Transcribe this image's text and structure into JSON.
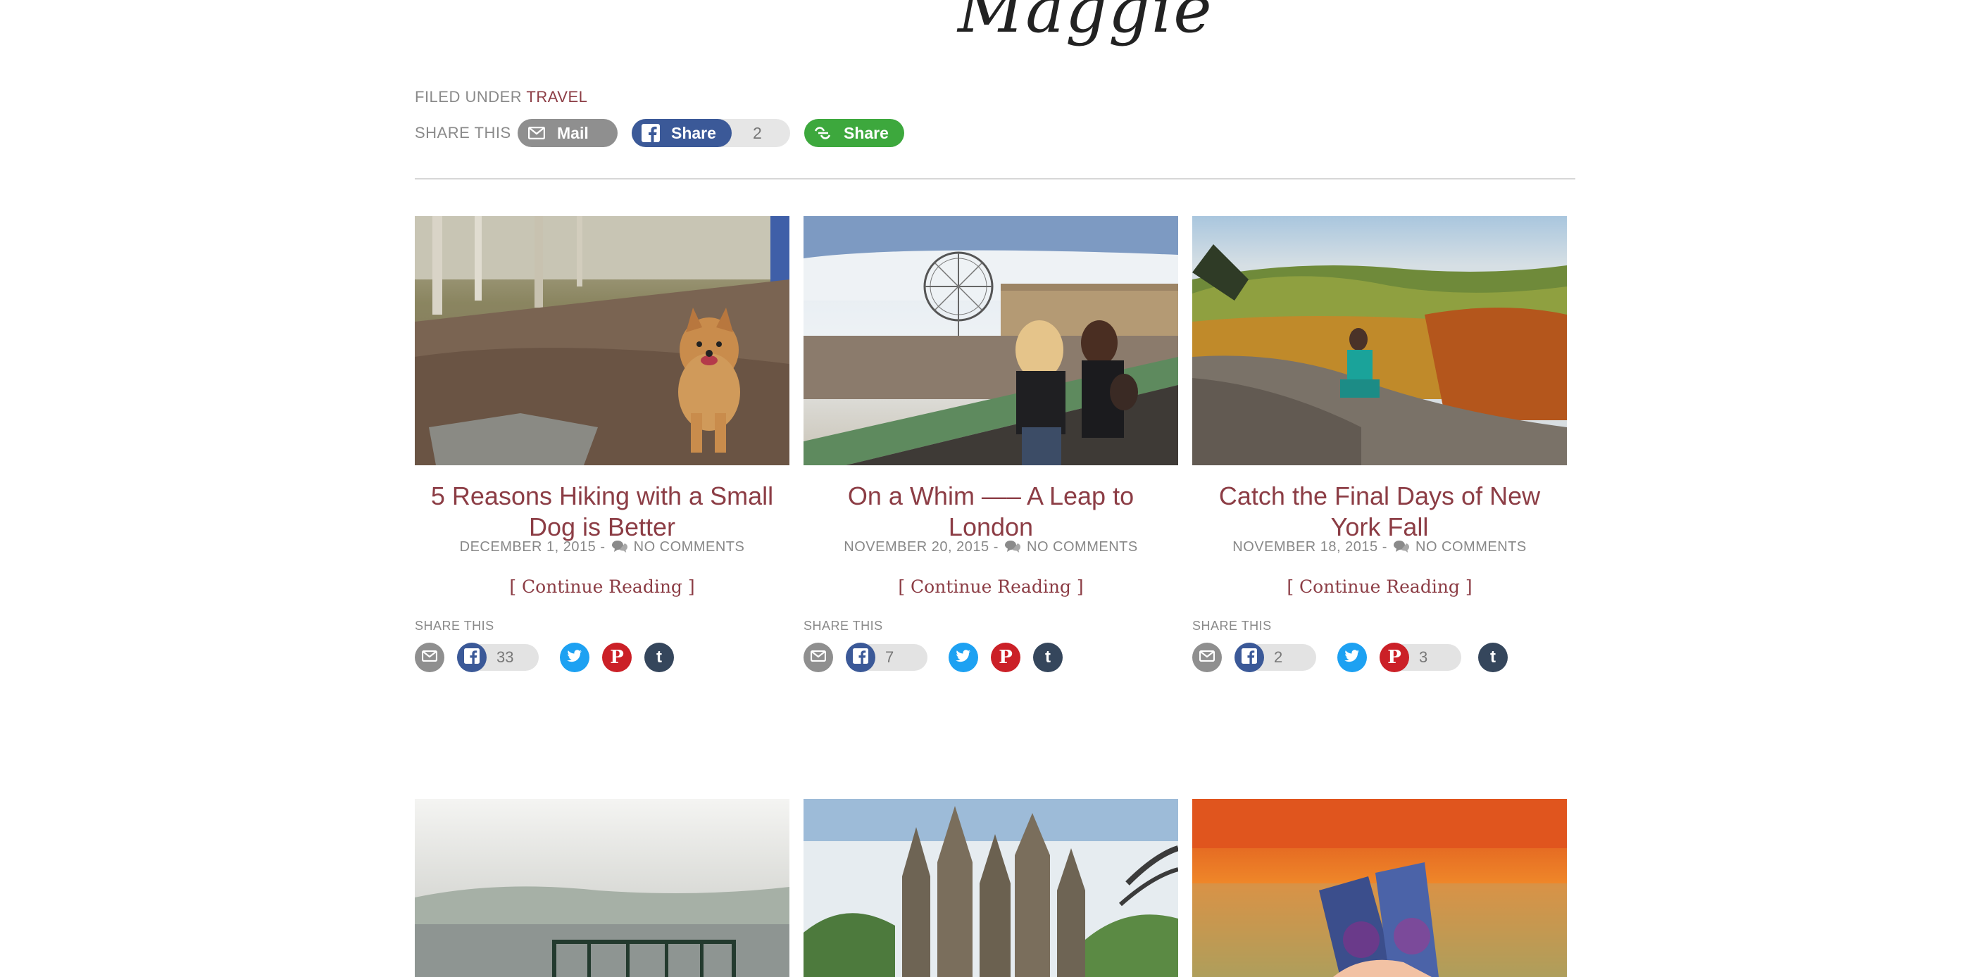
{
  "header": {
    "signature": "Maggie"
  },
  "post_meta": {
    "filed_under_label": "FILED UNDER",
    "category": "TRAVEL",
    "share_label": "SHARE THIS",
    "share_buttons": {
      "mail_label": "Mail",
      "facebook_label": "Share",
      "facebook_count": "2",
      "more_label": "Share"
    }
  },
  "colors": {
    "accent": "#8c3d45",
    "facebook": "#3b5998",
    "twitter": "#1da1f2",
    "pinterest": "#cb2027",
    "tumblr": "#35465c",
    "mail": "#8f8f8f",
    "share_more": "#3da83d"
  },
  "posts": [
    {
      "title": "5 Reasons Hiking with a Small Dog is Better",
      "date": "DECEMBER 1, 2015 -",
      "comments": "NO COMMENTS",
      "continue_label": "[ Continue Reading ]",
      "share_label": "SHARE THIS",
      "facebook_count": "33",
      "pinterest_count": ""
    },
    {
      "title": "On a Whim —– A Leap to London",
      "date": "NOVEMBER 20, 2015 -",
      "comments": "NO COMMENTS",
      "continue_label": "[ Continue Reading ]",
      "share_label": "SHARE THIS",
      "facebook_count": "7",
      "pinterest_count": ""
    },
    {
      "title": "Catch the Final Days of New York Fall",
      "date": "NOVEMBER 18, 2015 -",
      "comments": "NO COMMENTS",
      "continue_label": "[ Continue Reading ]",
      "share_label": "SHARE THIS",
      "facebook_count": "2",
      "pinterest_count": "3"
    }
  ],
  "icons": [
    "mail-icon",
    "facebook-icon",
    "twitter-icon",
    "pinterest-icon",
    "tumblr-icon",
    "share-icon",
    "comment-bubble-icon"
  ]
}
